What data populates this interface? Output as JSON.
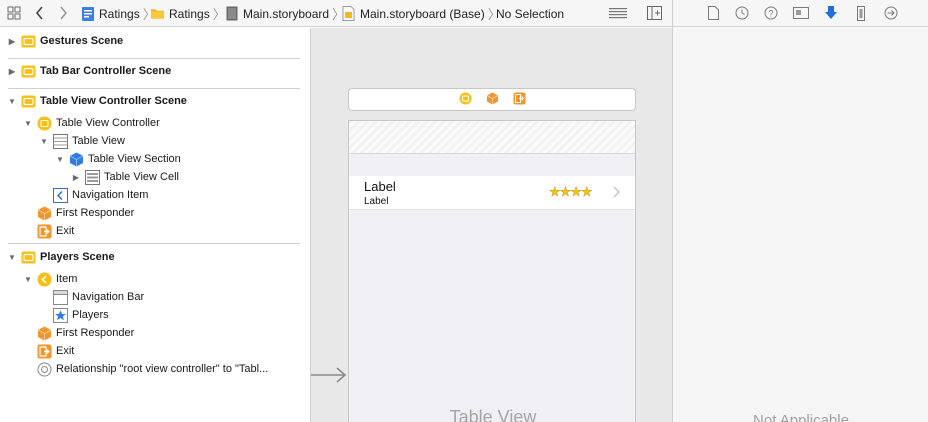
{
  "jumpbar": {
    "breadcrumb": [
      "Ratings",
      "Ratings",
      "Main.storyboard",
      "Main.storyboard (Base)",
      "No Selection"
    ],
    "separator": "〉"
  },
  "outline": {
    "scenes": [
      {
        "name": "Gestures Scene"
      },
      {
        "name": "Tab Bar Controller Scene"
      },
      {
        "name": "Table View Controller Scene",
        "items": [
          "Table View Controller",
          "Table View",
          "Table View Section",
          "Table View Cell",
          "Navigation Item",
          "First Responder",
          "Exit"
        ]
      },
      {
        "name": "Players Scene",
        "items": [
          "Item",
          "Navigation Bar",
          "Players",
          "First Responder",
          "Exit",
          "Relationship \"root view controller\" to \"Tabl..."
        ]
      }
    ]
  },
  "canvas": {
    "cell_title": "Label",
    "cell_subtitle": "Label",
    "stars": "★★★★",
    "placeholder": "Table View"
  },
  "inspector": {
    "empty_text": "Not Applicable"
  },
  "colors": {
    "accent": "#1e6fd9",
    "scene_icon": "#f6c018",
    "responder": "#f0962d"
  }
}
